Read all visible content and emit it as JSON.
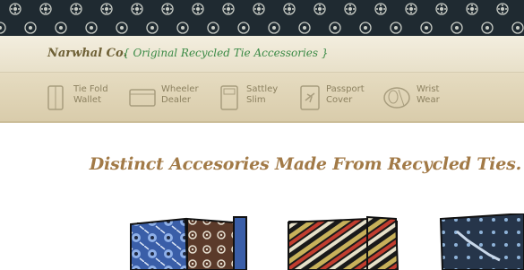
{
  "header": {
    "brand": "Narwhal Co.",
    "tagline": "{ Original Recycled Tie Accessories }"
  },
  "nav": {
    "items": [
      {
        "label": "Tie Fold\nWallet",
        "icon": "wallet-icon"
      },
      {
        "label": "Wheeler\nDealer",
        "icon": "card-holder-icon"
      },
      {
        "label": "Sattley\nSlim",
        "icon": "slim-wallet-icon"
      },
      {
        "label": "Passport\nCover",
        "icon": "passport-icon"
      },
      {
        "label": "Wrist\nWear",
        "icon": "wristband-icon"
      }
    ]
  },
  "main": {
    "headline": "Distinct Accesories Made From Recycled Ties."
  },
  "products": [
    {
      "name": "blue-paisley-wallet"
    },
    {
      "name": "striped-paisley-wallet"
    },
    {
      "name": "navy-pattern-wallet"
    }
  ],
  "colors": {
    "banner": "#1f2a31",
    "brand_text": "#6e6035",
    "tagline_text": "#3a8a45",
    "nav_text": "#8c8160",
    "headline_text": "#a27a47"
  }
}
